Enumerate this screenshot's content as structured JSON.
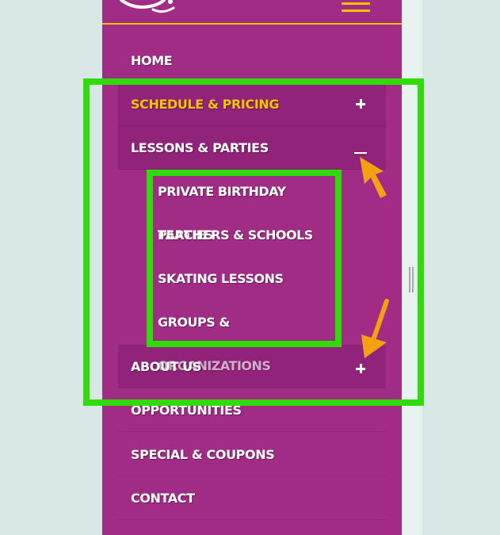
{
  "menu": {
    "items": [
      {
        "label": "HOME",
        "toggle": "",
        "active": false
      },
      {
        "label": "SCHEDULE & PRICING",
        "toggle": "plus",
        "active": true
      },
      {
        "label": "LESSONS & PARTIES",
        "toggle": "minus",
        "active": false
      },
      {
        "label": "ABOUT US",
        "toggle": "plus",
        "active": false
      },
      {
        "label": "OPPORTUNITIES",
        "toggle": "",
        "active": false
      },
      {
        "label": "SPECIAL & COUPONS",
        "toggle": "",
        "active": false
      },
      {
        "label": "CONTACT",
        "toggle": "",
        "active": false
      }
    ],
    "submenu": [
      {
        "label": "PRIVATE BIRTHDAY PARTIES"
      },
      {
        "label": "TEACHERS & SCHOOLS"
      },
      {
        "label": "SKATING LESSONS"
      },
      {
        "label": "GROUPS & ORGANIZATIONS"
      }
    ]
  },
  "colors": {
    "panel": "#a02c86",
    "accent": "#f5c400",
    "annotation_box": "#2fdc0a",
    "annotation_arrow": "#f5a010",
    "background": "#d9e8e6"
  },
  "icons": {
    "logo": "skate-logo-icon",
    "menu": "hamburger-icon",
    "expand": "plus-icon",
    "collapse": "minus-icon",
    "pointer": "arrow-icon"
  }
}
